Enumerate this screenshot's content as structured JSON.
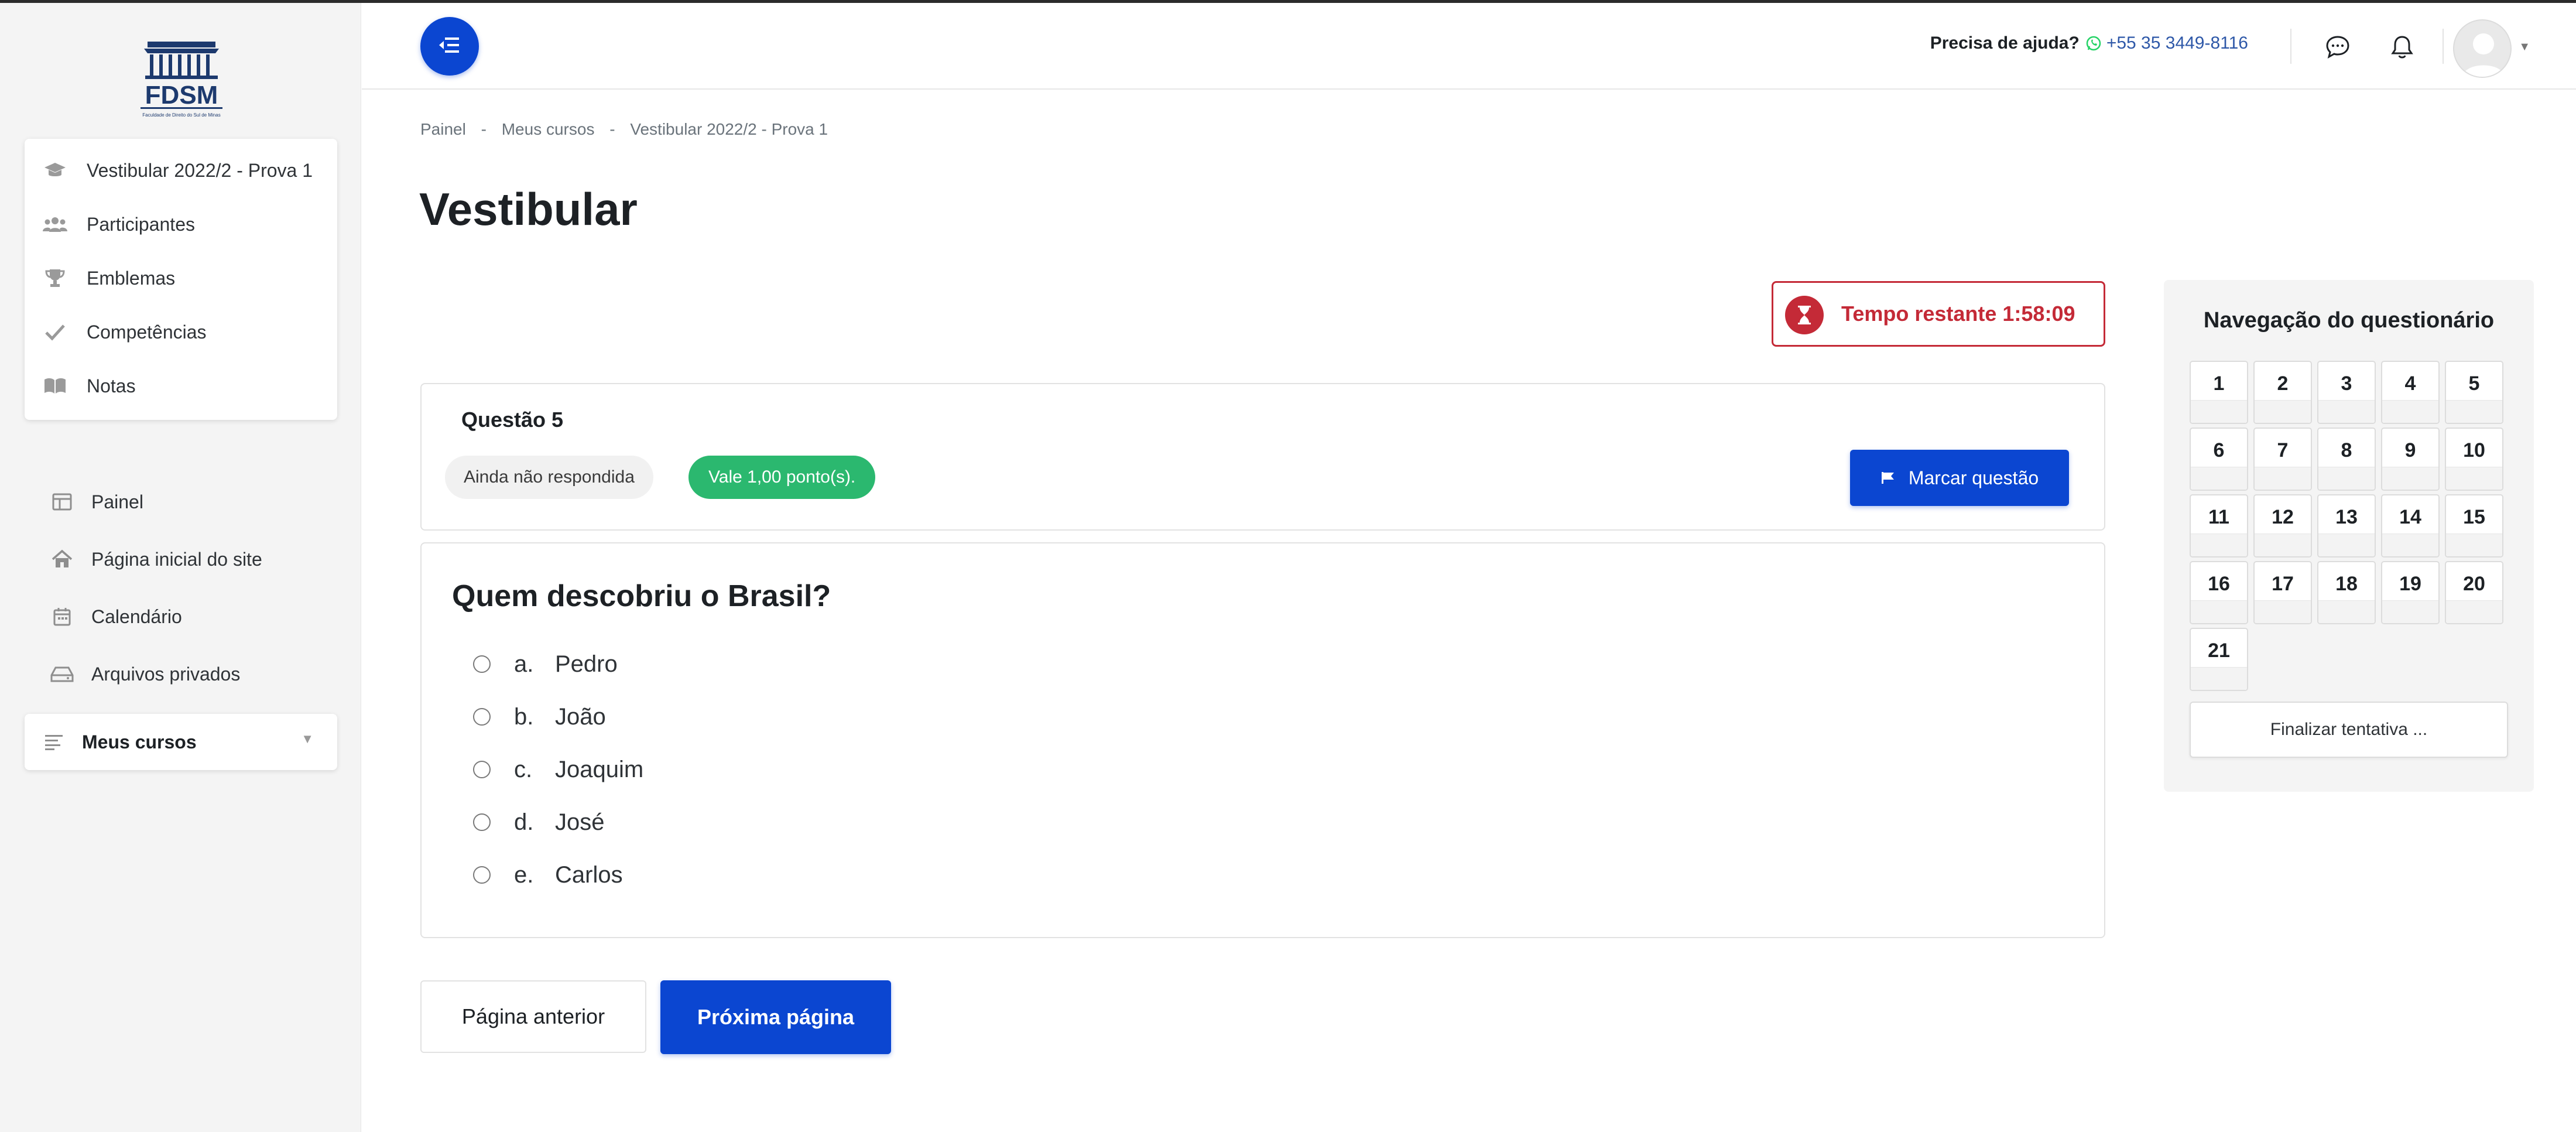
{
  "logo": {
    "text": "FDSM",
    "subtext": "Faculdade de Direito do Sul de Minas"
  },
  "sidebar": {
    "course_items": [
      {
        "label": "Vestibular 2022/2 - Prova 1",
        "icon": "graduation-cap-icon"
      },
      {
        "label": "Participantes",
        "icon": "users-icon"
      },
      {
        "label": "Emblemas",
        "icon": "trophy-icon"
      },
      {
        "label": "Competências",
        "icon": "check-icon"
      },
      {
        "label": "Notas",
        "icon": "book-icon"
      }
    ],
    "nav_items": [
      {
        "label": "Painel",
        "icon": "dashboard-icon"
      },
      {
        "label": "Página inicial do site",
        "icon": "home-icon"
      },
      {
        "label": "Calendário",
        "icon": "calendar-icon"
      },
      {
        "label": "Arquivos privados",
        "icon": "drive-icon"
      }
    ],
    "my_courses": {
      "label": "Meus cursos",
      "icon": "list-icon"
    }
  },
  "header": {
    "help_label": "Precisa de ajuda?",
    "phone": "+55 35 3449-8116",
    "icons": [
      "menu-toggle-icon",
      "whatsapp-icon",
      "message-icon",
      "bell-icon",
      "avatar"
    ]
  },
  "breadcrumb": [
    "Painel",
    "-",
    "Meus cursos",
    "-",
    "Vestibular 2022/2 - Prova 1"
  ],
  "page_title": "Vestibular",
  "timer": {
    "label": "Tempo restante 1:58:09"
  },
  "question": {
    "number_label": "Questão 5",
    "state": "Ainda não respondida",
    "grade": "Vale 1,00 ponto(s).",
    "flag_label": "Marcar questão",
    "text": "Quem descobriu o Brasil?",
    "answers": [
      {
        "letter": "a.",
        "text": "Pedro"
      },
      {
        "letter": "b.",
        "text": "João"
      },
      {
        "letter": "c.",
        "text": "Joaquim"
      },
      {
        "letter": "d.",
        "text": "José"
      },
      {
        "letter": "e.",
        "text": "Carlos"
      }
    ]
  },
  "buttons": {
    "prev": "Página anterior",
    "next": "Próxima página"
  },
  "quiz_nav": {
    "title": "Navegação do questionário",
    "numbers": [
      "1",
      "2",
      "3",
      "4",
      "5",
      "6",
      "7",
      "8",
      "9",
      "10",
      "11",
      "12",
      "13",
      "14",
      "15",
      "16",
      "17",
      "18",
      "19",
      "20",
      "21"
    ],
    "finish_label": "Finalizar tentativa ..."
  },
  "colors": {
    "primary": "#0b46d1",
    "danger": "#c42a37",
    "success": "#2bb86f",
    "whatsapp": "#25d366"
  }
}
